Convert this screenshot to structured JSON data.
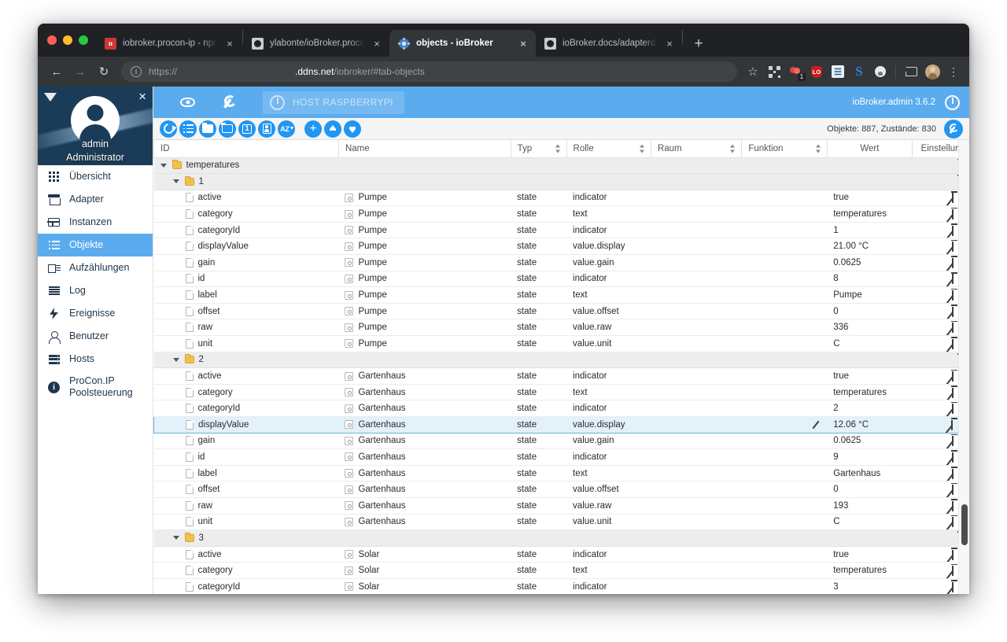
{
  "browser": {
    "tabs": [
      {
        "title": "iobroker.procon-ip - npm",
        "favicon": "npm-icon",
        "active": false
      },
      {
        "title": "ylabonte/ioBroker.procon-ip: A",
        "favicon": "github-icon",
        "active": false
      },
      {
        "title": "objects - ioBroker",
        "favicon": "iobroker-icon",
        "active": true
      },
      {
        "title": "ioBroker.docs/adapterdev.md a",
        "favicon": "github-icon",
        "active": false
      }
    ],
    "new_tab_label": "+",
    "close_label": "×",
    "nav": {
      "back": "←",
      "forward": "→",
      "reload": "↻"
    },
    "omnibox": {
      "info_glyph": "i",
      "scheme": "https://",
      "host": ".ddns.net",
      "path": "/iobroker/#tab-objects"
    },
    "extensions": [
      {
        "name": "bookmark-star-icon",
        "label": "☆"
      },
      {
        "name": "qr-code-icon",
        "label": ""
      },
      {
        "name": "extension-badge-icon",
        "label": "",
        "badge": "1"
      },
      {
        "name": "red-shield-icon",
        "label": "LO"
      },
      {
        "name": "blue-square-icon",
        "label": "☰"
      },
      {
        "name": "s-extension-icon",
        "label": "S"
      },
      {
        "name": "circle-extension-icon",
        "label": ""
      },
      {
        "name": "cast-icon",
        "label": ""
      },
      {
        "name": "profile-avatar",
        "label": ""
      },
      {
        "name": "chrome-menu-icon",
        "label": "⋮"
      }
    ]
  },
  "sidebar": {
    "caret_icon": "collapse-caret-icon",
    "close_icon": "close-icon",
    "avatar_icon": "user-avatar",
    "user_name": "admin",
    "user_role": "Administrator",
    "items": [
      {
        "label": "Übersicht",
        "icon": "grid-icon",
        "selected": false
      },
      {
        "label": "Adapter",
        "icon": "store-icon",
        "selected": false
      },
      {
        "label": "Instanzen",
        "icon": "instances-icon",
        "selected": false
      },
      {
        "label": "Objekte",
        "icon": "list-icon",
        "selected": true
      },
      {
        "label": "Aufzählungen",
        "icon": "enum-icon",
        "selected": false
      },
      {
        "label": "Log",
        "icon": "log-icon",
        "selected": false
      },
      {
        "label": "Ereignisse",
        "icon": "bolt-icon",
        "selected": false
      },
      {
        "label": "Benutzer",
        "icon": "user-icon",
        "selected": false
      },
      {
        "label": "Hosts",
        "icon": "hosts-icon",
        "selected": false
      },
      {
        "label": "ProCon.IP Poolsteuerung",
        "icon": "info-icon",
        "selected": false
      }
    ]
  },
  "appbar": {
    "eye_icon": "eye-icon",
    "wrench_icon": "wrench-icon",
    "host_label": "HOST RASPBERRYPI",
    "host_power_icon": "power-icon",
    "version": "ioBroker.admin 3.6.2",
    "power_icon": "power-icon",
    "accent_color": "#5bacee"
  },
  "toolbar": {
    "buttons": [
      {
        "name": "refresh-button",
        "icon": "refresh-icon"
      },
      {
        "name": "expand-list-button",
        "icon": "bullet-list-icon"
      },
      {
        "name": "expand-all-folders-button",
        "icon": "folder-filled-icon"
      },
      {
        "name": "collapse-all-folders-button",
        "icon": "folder-outline-icon"
      },
      {
        "name": "level-one-button",
        "icon": "box-one-icon",
        "label": "1"
      },
      {
        "name": "show-id-button",
        "icon": "id-card-icon"
      },
      {
        "name": "sort-az-button",
        "icon": "sort-az-icon",
        "label": "AZ"
      },
      {
        "name": "add-object-button",
        "icon": "plus-icon"
      },
      {
        "name": "import-button",
        "icon": "arrow-up-icon"
      },
      {
        "name": "export-button",
        "icon": "arrow-down-icon"
      }
    ],
    "stats": "Objekte: 887, Zustände: 830",
    "settings_button": "wrench-icon",
    "button_color": "#2196f3"
  },
  "table": {
    "columns": [
      {
        "key": "id",
        "label": "ID",
        "sortable": false,
        "align": "left"
      },
      {
        "key": "name",
        "label": "Name",
        "sortable": false,
        "align": "left"
      },
      {
        "key": "typ",
        "label": "Typ",
        "sortable": true,
        "align": "left"
      },
      {
        "key": "rolle",
        "label": "Rolle",
        "sortable": true,
        "align": "left"
      },
      {
        "key": "raum",
        "label": "Raum",
        "sortable": true,
        "align": "left"
      },
      {
        "key": "funktion",
        "label": "Funktion",
        "sortable": true,
        "align": "left"
      },
      {
        "key": "wert",
        "label": "Wert",
        "sortable": false,
        "align": "center"
      },
      {
        "key": "einstellungen",
        "label": "Einstellun",
        "sortable": true,
        "align": "center"
      }
    ],
    "rows": [
      {
        "kind": "folder",
        "indent": 0,
        "id": "temperatures",
        "name": "",
        "typ": "",
        "rolle": "",
        "raum": "",
        "funktion": "",
        "wert": "",
        "actions": [
          "trash"
        ]
      },
      {
        "kind": "folder",
        "indent": 1,
        "id": "1",
        "name": "",
        "typ": "",
        "rolle": "",
        "raum": "",
        "funktion": "",
        "wert": "",
        "actions": [
          "trash"
        ]
      },
      {
        "kind": "leaf",
        "indent": 2,
        "id": "active",
        "name": "Pumpe",
        "typ": "state",
        "rolle": "indicator",
        "raum": "",
        "funktion": "",
        "wert": "true",
        "actions": [
          "pencil",
          "trash",
          "wrench"
        ]
      },
      {
        "kind": "leaf",
        "indent": 2,
        "id": "category",
        "name": "Pumpe",
        "typ": "state",
        "rolle": "text",
        "raum": "",
        "funktion": "",
        "wert": "temperatures",
        "actions": [
          "pencil",
          "trash",
          "wrench"
        ]
      },
      {
        "kind": "leaf",
        "indent": 2,
        "id": "categoryId",
        "name": "Pumpe",
        "typ": "state",
        "rolle": "indicator",
        "raum": "",
        "funktion": "",
        "wert": "1",
        "actions": [
          "pencil",
          "trash",
          "wrench"
        ]
      },
      {
        "kind": "leaf",
        "indent": 2,
        "id": "displayValue",
        "name": "Pumpe",
        "typ": "state",
        "rolle": "value.display",
        "raum": "",
        "funktion": "",
        "wert": "21.00 °C",
        "actions": [
          "pencil",
          "trash",
          "wrench"
        ]
      },
      {
        "kind": "leaf",
        "indent": 2,
        "id": "gain",
        "name": "Pumpe",
        "typ": "state",
        "rolle": "value.gain",
        "raum": "",
        "funktion": "",
        "wert": "0.0625",
        "actions": [
          "pencil",
          "trash",
          "wrench"
        ]
      },
      {
        "kind": "leaf",
        "indent": 2,
        "id": "id",
        "name": "Pumpe",
        "typ": "state",
        "rolle": "indicator",
        "raum": "",
        "funktion": "",
        "wert": "8",
        "actions": [
          "pencil",
          "trash",
          "wrench"
        ]
      },
      {
        "kind": "leaf",
        "indent": 2,
        "id": "label",
        "name": "Pumpe",
        "typ": "state",
        "rolle": "text",
        "raum": "",
        "funktion": "",
        "wert": "Pumpe",
        "actions": [
          "pencil",
          "trash",
          "wrench"
        ]
      },
      {
        "kind": "leaf",
        "indent": 2,
        "id": "offset",
        "name": "Pumpe",
        "typ": "state",
        "rolle": "value.offset",
        "raum": "",
        "funktion": "",
        "wert": "0",
        "actions": [
          "pencil",
          "trash",
          "wrench"
        ]
      },
      {
        "kind": "leaf",
        "indent": 2,
        "id": "raw",
        "name": "Pumpe",
        "typ": "state",
        "rolle": "value.raw",
        "raum": "",
        "funktion": "",
        "wert": "336",
        "actions": [
          "pencil",
          "trash",
          "wrench"
        ]
      },
      {
        "kind": "leaf",
        "indent": 2,
        "id": "unit",
        "name": "Pumpe",
        "typ": "state",
        "rolle": "value.unit",
        "raum": "",
        "funktion": "",
        "wert": "C",
        "actions": [
          "pencil",
          "trash",
          "wrench"
        ]
      },
      {
        "kind": "folder",
        "indent": 1,
        "id": "2",
        "name": "",
        "typ": "",
        "rolle": "",
        "raum": "",
        "funktion": "",
        "wert": "",
        "actions": [
          "trash"
        ]
      },
      {
        "kind": "leaf",
        "indent": 2,
        "id": "active",
        "name": "Gartenhaus",
        "typ": "state",
        "rolle": "indicator",
        "raum": "",
        "funktion": "",
        "wert": "true",
        "actions": [
          "pencil",
          "trash",
          "wrench"
        ]
      },
      {
        "kind": "leaf",
        "indent": 2,
        "id": "category",
        "name": "Gartenhaus",
        "typ": "state",
        "rolle": "text",
        "raum": "",
        "funktion": "",
        "wert": "temperatures",
        "actions": [
          "pencil",
          "trash",
          "wrench"
        ]
      },
      {
        "kind": "leaf",
        "indent": 2,
        "id": "categoryId",
        "name": "Gartenhaus",
        "typ": "state",
        "rolle": "indicator",
        "raum": "",
        "funktion": "",
        "wert": "2",
        "actions": [
          "pencil",
          "trash",
          "wrench"
        ]
      },
      {
        "kind": "leaf",
        "indent": 2,
        "id": "displayValue",
        "name": "Gartenhaus",
        "typ": "state",
        "rolle": "value.display",
        "raum": "",
        "funktion": "pencil",
        "wert": "12.06 °C",
        "selected": true,
        "actions": [
          "pencil",
          "trash",
          "wrench"
        ]
      },
      {
        "kind": "leaf",
        "indent": 2,
        "id": "gain",
        "name": "Gartenhaus",
        "typ": "state",
        "rolle": "value.gain",
        "raum": "",
        "funktion": "",
        "wert": "0.0625",
        "actions": [
          "pencil",
          "trash",
          "wrench"
        ]
      },
      {
        "kind": "leaf",
        "indent": 2,
        "id": "id",
        "name": "Gartenhaus",
        "typ": "state",
        "rolle": "indicator",
        "raum": "",
        "funktion": "",
        "wert": "9",
        "actions": [
          "pencil",
          "trash",
          "wrench"
        ]
      },
      {
        "kind": "leaf",
        "indent": 2,
        "id": "label",
        "name": "Gartenhaus",
        "typ": "state",
        "rolle": "text",
        "raum": "",
        "funktion": "",
        "wert": "Gartenhaus",
        "actions": [
          "pencil",
          "trash",
          "wrench"
        ]
      },
      {
        "kind": "leaf",
        "indent": 2,
        "id": "offset",
        "name": "Gartenhaus",
        "typ": "state",
        "rolle": "value.offset",
        "raum": "",
        "funktion": "",
        "wert": "0",
        "actions": [
          "pencil",
          "trash",
          "wrench"
        ]
      },
      {
        "kind": "leaf",
        "indent": 2,
        "id": "raw",
        "name": "Gartenhaus",
        "typ": "state",
        "rolle": "value.raw",
        "raum": "",
        "funktion": "",
        "wert": "193",
        "actions": [
          "pencil",
          "trash",
          "wrench"
        ]
      },
      {
        "kind": "leaf",
        "indent": 2,
        "id": "unit",
        "name": "Gartenhaus",
        "typ": "state",
        "rolle": "value.unit",
        "raum": "",
        "funktion": "",
        "wert": "C",
        "actions": [
          "pencil",
          "trash",
          "wrench"
        ]
      },
      {
        "kind": "folder",
        "indent": 1,
        "id": "3",
        "name": "",
        "typ": "",
        "rolle": "",
        "raum": "",
        "funktion": "",
        "wert": "",
        "actions": [
          "trash"
        ]
      },
      {
        "kind": "leaf",
        "indent": 2,
        "id": "active",
        "name": "Solar",
        "typ": "state",
        "rolle": "indicator",
        "raum": "",
        "funktion": "",
        "wert": "true",
        "actions": [
          "pencil",
          "trash",
          "wrench"
        ]
      },
      {
        "kind": "leaf",
        "indent": 2,
        "id": "category",
        "name": "Solar",
        "typ": "state",
        "rolle": "text",
        "raum": "",
        "funktion": "",
        "wert": "temperatures",
        "actions": [
          "pencil",
          "trash",
          "wrench"
        ]
      },
      {
        "kind": "leaf",
        "indent": 2,
        "id": "categoryId",
        "name": "Solar",
        "typ": "state",
        "rolle": "indicator",
        "raum": "",
        "funktion": "",
        "wert": "3",
        "actions": [
          "pencil",
          "trash",
          "wrench"
        ]
      }
    ]
  }
}
